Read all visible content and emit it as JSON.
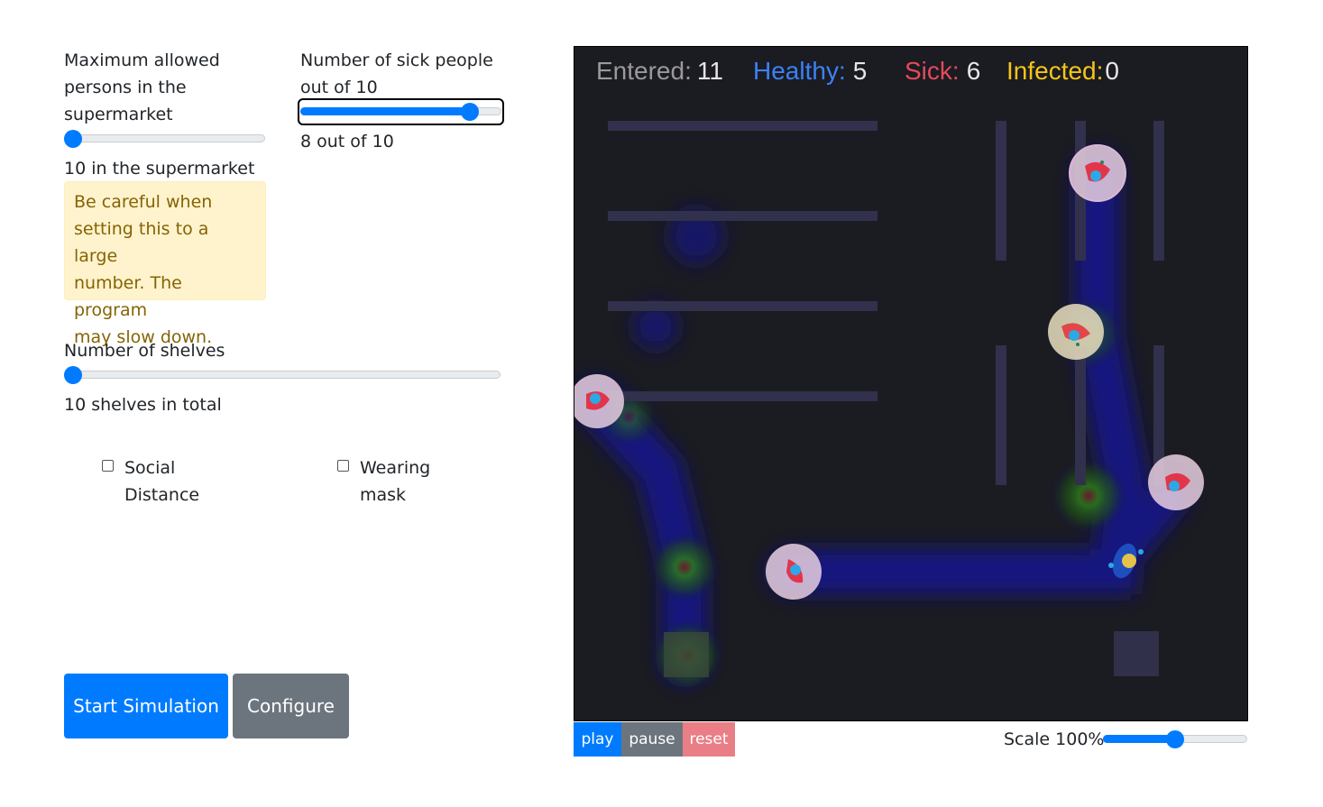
{
  "controls": {
    "max_persons": {
      "label_lines": [
        "Maximum allowed",
        "persons in the",
        "supermarket"
      ],
      "value": 10,
      "slider_fraction": 0.0,
      "value_text": "10 in the supermarket",
      "warning": [
        "Be careful when",
        "setting this to a large",
        "number. The program",
        "may slow down."
      ]
    },
    "sick_people": {
      "label_lines": [
        "Number of sick people",
        "out of 10"
      ],
      "value": 8,
      "slider_fraction": 0.85,
      "value_text": "8 out of 10"
    },
    "shelves": {
      "label": "Number of shelves",
      "value": 10,
      "slider_fraction": 0.0,
      "value_text": "10 shelves in total"
    },
    "social_distance": {
      "label_lines": [
        "Social",
        "Distance"
      ],
      "checked": false
    },
    "wearing_mask": {
      "label_lines": [
        "Wearing",
        "mask"
      ],
      "checked": false
    },
    "start_button": "Start Simulation",
    "configure_button": "Configure"
  },
  "simulation": {
    "stats": {
      "entered_label": "Entered:",
      "entered_value": "11",
      "healthy_label": "Healthy:",
      "healthy_value": "5",
      "sick_label": "Sick:",
      "sick_value": "6",
      "infected_label": "Infected:",
      "infected_value": "0"
    },
    "colors": {
      "entered": "#aaaaaa",
      "healthy": "#3b82f6",
      "sick": "#e34a5a",
      "infected": "#f5c518",
      "background": "#1b1b22"
    },
    "playback": {
      "play": "play",
      "pause": "pause",
      "reset": "reset"
    },
    "scale": {
      "label": "Scale 100%",
      "slider_fraction": 0.5
    }
  }
}
